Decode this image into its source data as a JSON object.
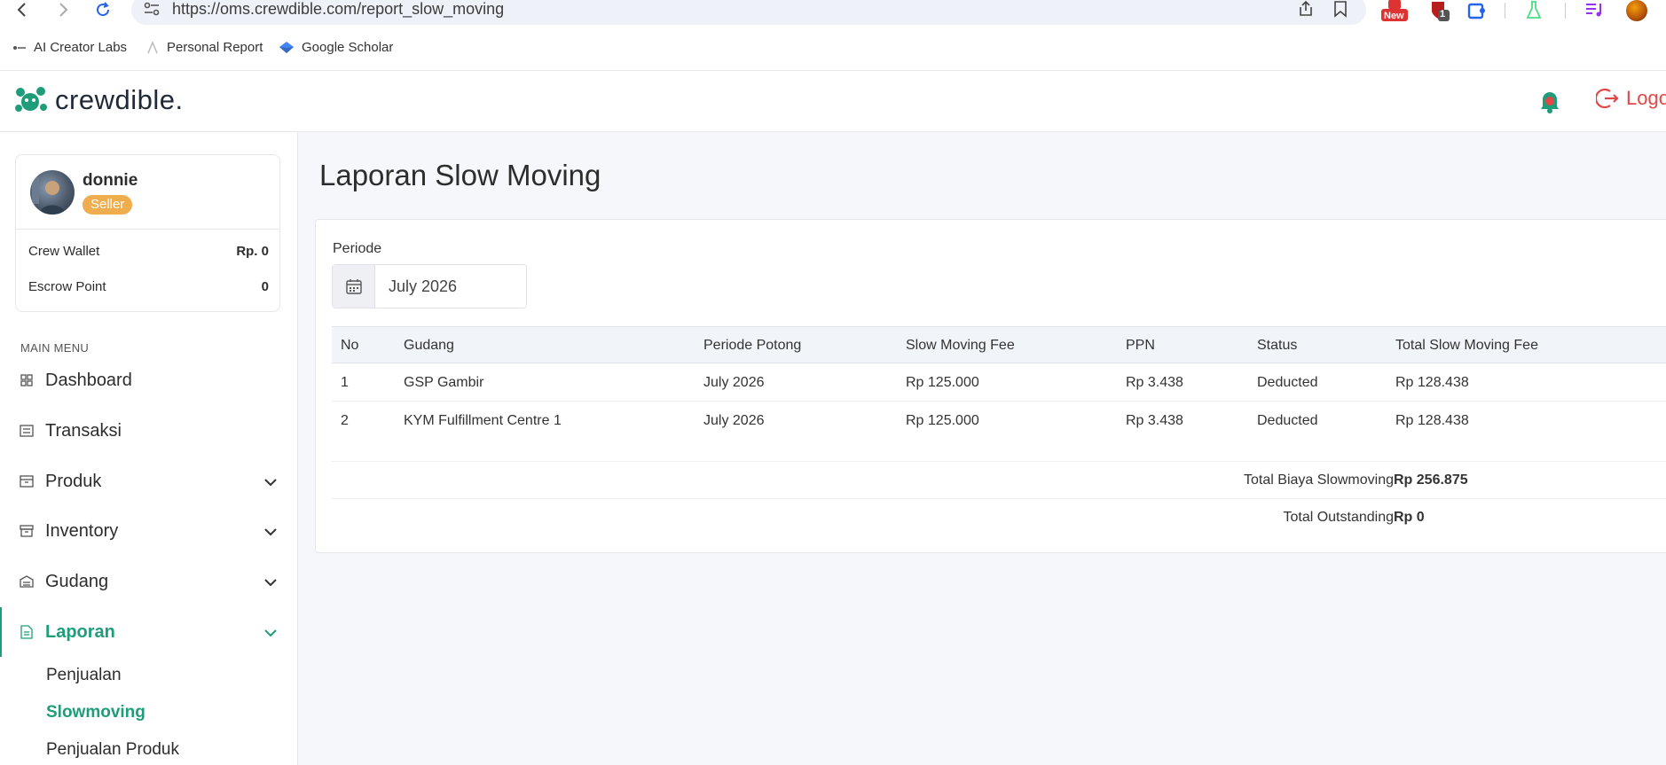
{
  "browser": {
    "url": "https://oms.crewdible.com/report_slow_moving",
    "ext_badge_new": "New",
    "ext_badge_count": "1",
    "bookmarks": [
      {
        "label": "AI Creator Labs"
      },
      {
        "label": "Personal Report"
      },
      {
        "label": "Google Scholar"
      }
    ]
  },
  "header": {
    "brand": "crewdible.",
    "logout_label": "Logo"
  },
  "colors": {
    "brand_green": "#1f9d7a",
    "badge_orange": "#f0ad4e",
    "logout_red": "#e04848"
  },
  "profile": {
    "name": "donnie",
    "role": "Seller",
    "wallet_label": "Crew Wallet",
    "wallet_value": "Rp. 0",
    "escrow_label": "Escrow Point",
    "escrow_value": "0"
  },
  "menu": {
    "title": "MAIN MENU",
    "items": [
      {
        "label": "Dashboard",
        "icon": "grid-icon"
      },
      {
        "label": "Transaksi",
        "icon": "receipt-icon"
      },
      {
        "label": "Produk",
        "icon": "box-icon"
      },
      {
        "label": "Inventory",
        "icon": "archive-icon"
      },
      {
        "label": "Gudang",
        "icon": "warehouse-icon"
      },
      {
        "label": "Laporan",
        "icon": "document-icon"
      }
    ],
    "sub_items": [
      {
        "label": "Penjualan"
      },
      {
        "label": "Slowmoving"
      },
      {
        "label": "Penjualan Produk"
      }
    ]
  },
  "page": {
    "title": "Laporan Slow Moving",
    "periode_label": "Periode",
    "periode_value": "July 2026"
  },
  "table": {
    "columns": [
      "No",
      "Gudang",
      "Periode Potong",
      "Slow Moving Fee",
      "PPN",
      "Status",
      "Total Slow Moving Fee"
    ],
    "rows": [
      [
        "1",
        "GSP Gambir",
        "July 2026",
        "Rp 125.000",
        "Rp 3.438",
        "Deducted",
        "Rp 128.438"
      ],
      [
        "2",
        "KYM Fulfillment Centre 1",
        "July 2026",
        "Rp 125.000",
        "Rp 3.438",
        "Deducted",
        "Rp 128.438"
      ]
    ],
    "summary": [
      {
        "label": "Total Biaya Slowmoving",
        "value": "Rp 256.875"
      },
      {
        "label": "Total Outstanding",
        "value": "Rp 0"
      }
    ]
  }
}
